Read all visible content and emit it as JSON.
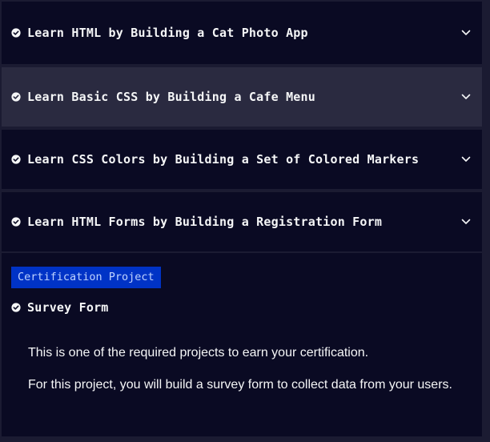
{
  "lessons": [
    {
      "title": "Learn HTML by Building a Cat Photo App",
      "icon": "check-circle-icon",
      "toggle_icon": "chevron-down-icon"
    },
    {
      "title": "Learn Basic CSS by Building a Cafe Menu",
      "icon": "check-circle-icon",
      "toggle_icon": "chevron-down-icon"
    },
    {
      "title": "Learn CSS Colors by Building a Set of Colored Markers",
      "icon": "check-circle-icon",
      "toggle_icon": "chevron-down-icon"
    },
    {
      "title": "Learn HTML Forms by Building a Registration Form",
      "icon": "check-circle-icon",
      "toggle_icon": "chevron-down-icon"
    }
  ],
  "certification": {
    "badge": "Certification Project",
    "project_title": "Survey Form",
    "project_icon": "check-circle-icon",
    "description": [
      "This is one of the required projects to earn your certification.",
      "For this project, you will build a survey form to collect data from your users."
    ]
  },
  "colors": {
    "page_background": "#1b1b32",
    "panel_background": "#0a0a23",
    "hover_background": "#2a2a40",
    "badge_background": "#0033c6",
    "badge_text": "#bfd3ff",
    "text": "#f5f6f7"
  }
}
